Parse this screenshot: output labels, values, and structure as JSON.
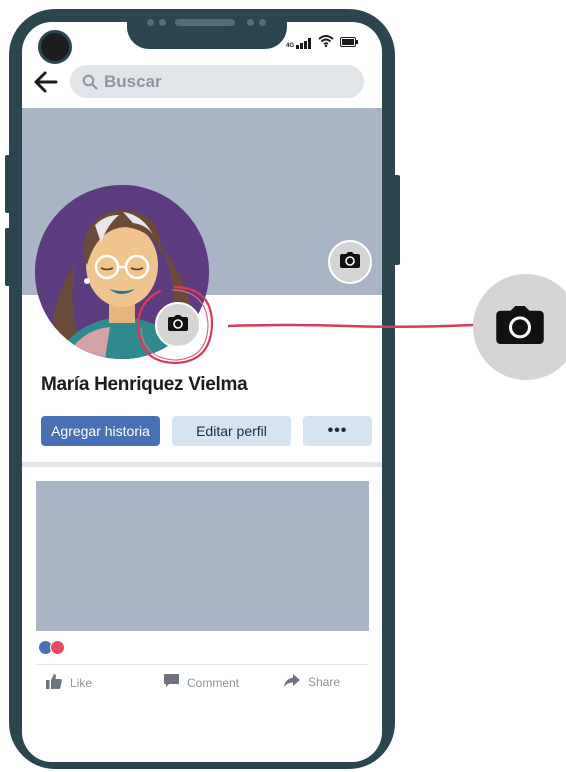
{
  "search": {
    "placeholder": "Buscar"
  },
  "profile": {
    "name": "María Henriquez Vielma"
  },
  "buttons": {
    "add_story": "Agregar historia",
    "edit_profile": "Editar perfil",
    "more": "•••"
  },
  "status_bar": {
    "network": "4G"
  },
  "post": {
    "actions": {
      "like": "Like",
      "comment": "Comment",
      "share": "Share"
    }
  },
  "icons": {
    "back": "arrow-left-icon",
    "search": "search-icon",
    "cover_camera": "camera-icon",
    "avatar_camera": "camera-icon",
    "zoom_camera": "camera-icon",
    "like": "thumbs-up-icon",
    "comment": "comment-icon",
    "share": "share-arrow-icon"
  },
  "colors": {
    "phone_frame": "#2c4650",
    "cover": "#a9b5c5",
    "primary_button": "#4770b5",
    "secondary_button": "#d6e3f1",
    "highlight_annotation": "#d83a5a",
    "avatar_background": "#5c3c7e"
  }
}
